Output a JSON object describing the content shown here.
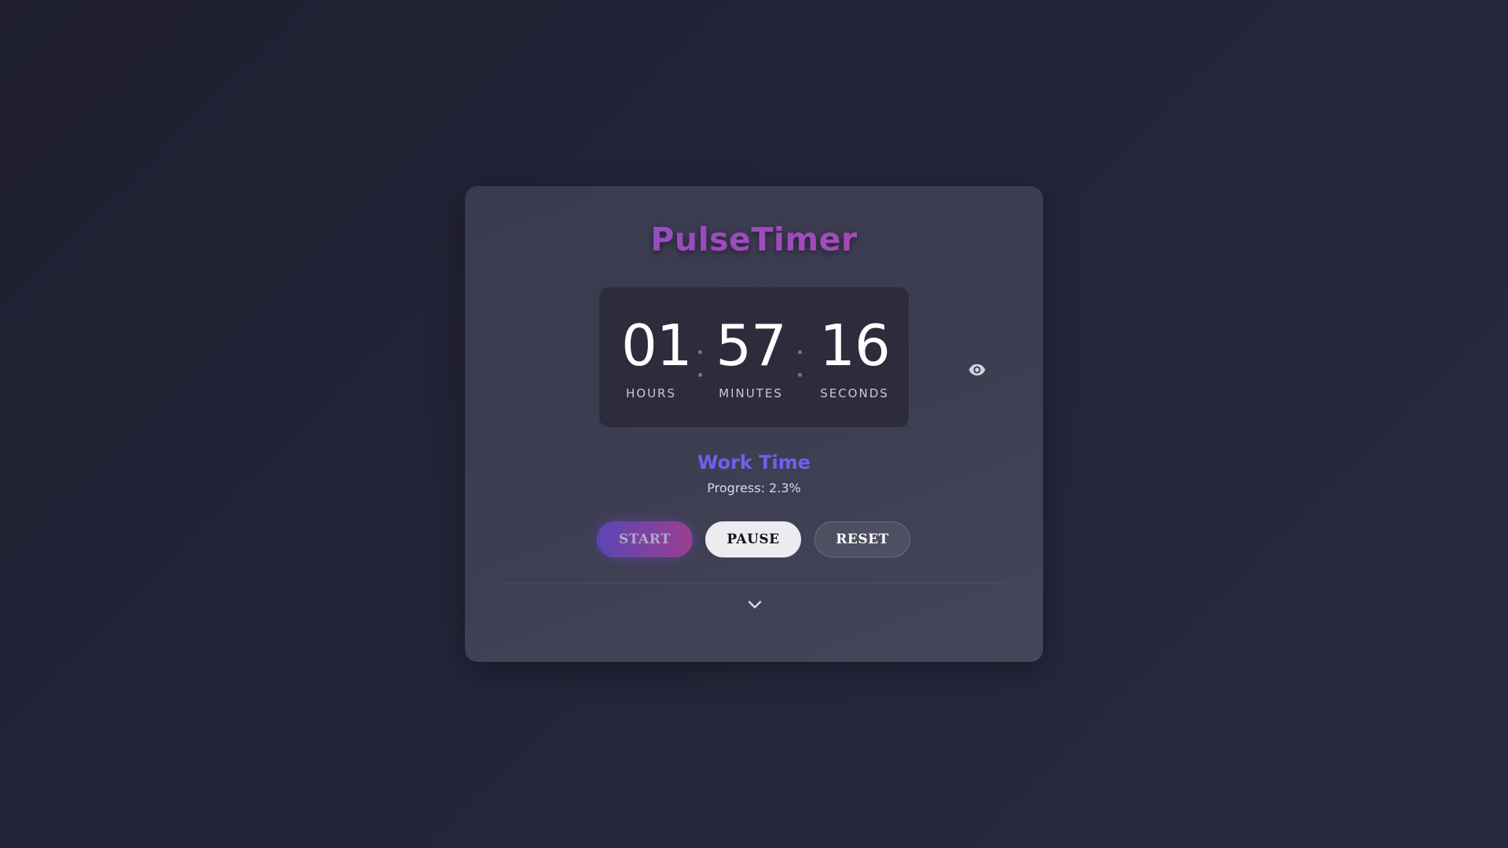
{
  "app": {
    "title": "PulseTimer"
  },
  "timer": {
    "hours": "01",
    "minutes": "57",
    "seconds": "16",
    "hours_label": "HOURS",
    "minutes_label": "MINUTES",
    "seconds_label": "SECONDS"
  },
  "status": {
    "mode": "Work Time",
    "progress_text": "Progress: 2.3%"
  },
  "controls": {
    "start_label": "START",
    "pause_label": "PAUSE",
    "reset_label": "RESET"
  },
  "icons": {
    "visibility_toggle": "eye-icon",
    "expand": "chevron-down-icon"
  },
  "colors": {
    "title_gradient_start": "#8d4cc9",
    "title_gradient_end": "#b04ab0",
    "mode_color": "#6b63ee",
    "start_gradient_start": "#5b46b4",
    "start_gradient_end": "#9a3f8e"
  }
}
